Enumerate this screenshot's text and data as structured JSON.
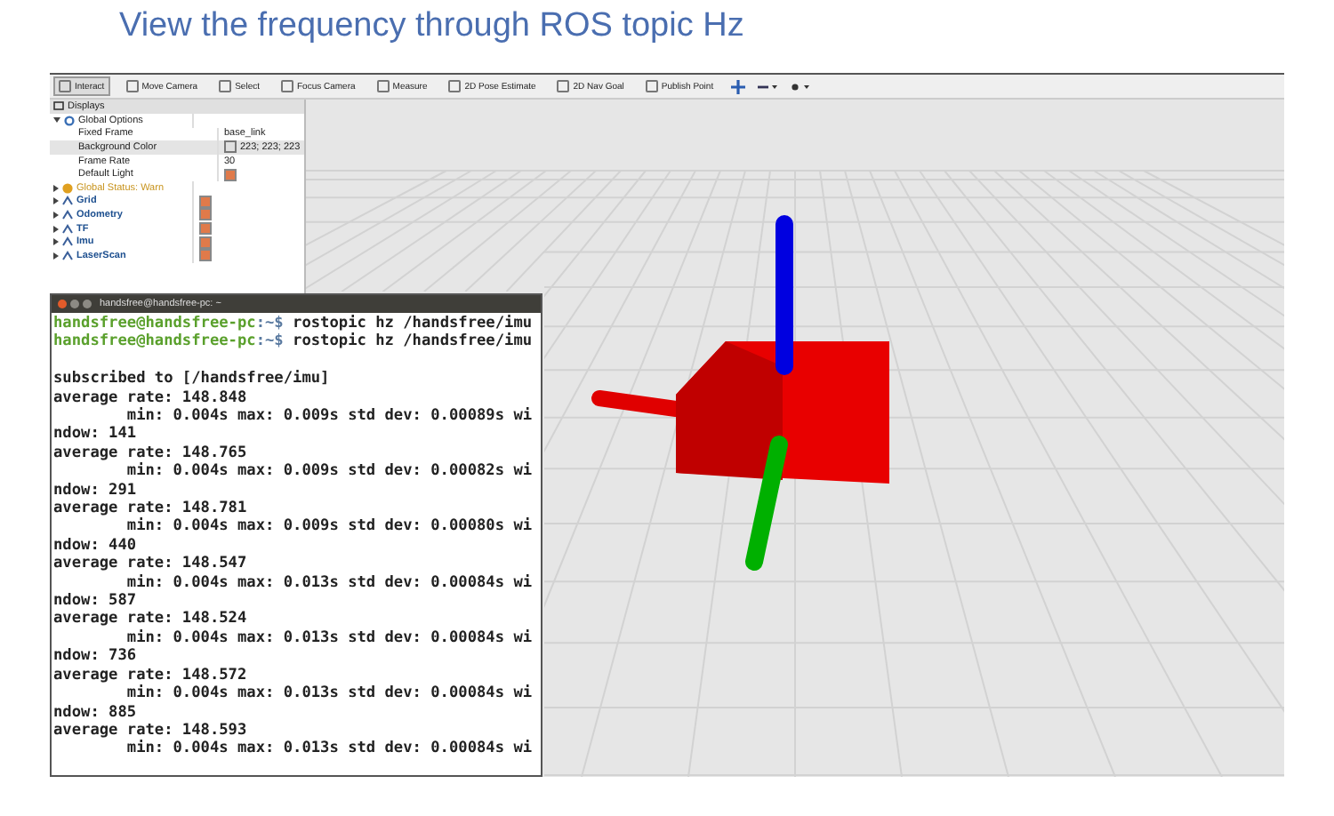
{
  "title": "View the frequency through ROS topic Hz",
  "toolbar": [
    {
      "label": "Interact",
      "selected": true
    },
    {
      "label": "Move Camera",
      "selected": false
    },
    {
      "label": "Select",
      "selected": false
    },
    {
      "label": "Focus Camera",
      "selected": false
    },
    {
      "label": "Measure",
      "selected": false
    },
    {
      "label": "2D Pose Estimate",
      "selected": false
    },
    {
      "label": "2D Nav Goal",
      "selected": false
    },
    {
      "label": "Publish Point",
      "selected": false
    }
  ],
  "displays": {
    "title": "Displays",
    "items": [
      {
        "label": "Global Options",
        "kind": "group",
        "expanded": true,
        "selected": false,
        "children": [
          {
            "label": "Fixed Frame",
            "value": "base_link",
            "selected": false
          },
          {
            "label": "Background Color",
            "value": "223; 223; 223",
            "kind": "color",
            "selected": true
          },
          {
            "label": "Frame Rate",
            "value": "30",
            "selected": false
          },
          {
            "label": "Default Light",
            "checked": true,
            "selected": false
          }
        ]
      },
      {
        "label": "Global Status: Warn",
        "kind": "status",
        "expanded": false,
        "selected": false
      },
      {
        "label": "Grid",
        "kind": "display",
        "expanded": false,
        "checked": true,
        "selected": false
      },
      {
        "label": "Odometry",
        "kind": "display",
        "expanded": false,
        "checked": true,
        "selected": false
      },
      {
        "label": "TF",
        "kind": "display",
        "expanded": false,
        "checked": true,
        "selected": false
      },
      {
        "label": "Imu",
        "kind": "display",
        "expanded": false,
        "checked": true,
        "selected": false
      },
      {
        "label": "LaserScan",
        "kind": "display",
        "expanded": false,
        "checked": true,
        "selected": false
      }
    ]
  },
  "terminal": {
    "title": "handsfree@handsfree-pc: ~",
    "lines": [
      {
        "kind": "prompt",
        "user": "handsfree@handsfree-pc",
        "path": ":~$",
        "command": "rostopic hz /handsfree/imu"
      },
      {
        "kind": "prompt",
        "user": "handsfree@handsfree-pc",
        "path": ":~$",
        "command": "rostopic hz /handsfree/imu"
      },
      {
        "kind": "blank"
      },
      {
        "kind": "output",
        "text": "subscribed to [/handsfree/imu]"
      },
      {
        "kind": "output",
        "text": "average rate: 148.848"
      },
      {
        "kind": "output",
        "text": "        min: 0.004s max: 0.009s std dev: 0.00089s wi"
      },
      {
        "kind": "output",
        "text": "ndow: 141"
      },
      {
        "kind": "output",
        "text": "average rate: 148.765"
      },
      {
        "kind": "output",
        "text": "        min: 0.004s max: 0.009s std dev: 0.00082s wi"
      },
      {
        "kind": "output",
        "text": "ndow: 291"
      },
      {
        "kind": "output",
        "text": "average rate: 148.781"
      },
      {
        "kind": "output",
        "text": "        min: 0.004s max: 0.009s std dev: 0.00080s wi"
      },
      {
        "kind": "output",
        "text": "ndow: 440"
      },
      {
        "kind": "output",
        "text": "average rate: 148.547"
      },
      {
        "kind": "output",
        "text": "        min: 0.004s max: 0.013s std dev: 0.00084s wi"
      },
      {
        "kind": "output",
        "text": "ndow: 587"
      },
      {
        "kind": "output",
        "text": "average rate: 148.524"
      },
      {
        "kind": "output",
        "text": "        min: 0.004s max: 0.013s std dev: 0.00084s wi"
      },
      {
        "kind": "output",
        "text": "ndow: 736"
      },
      {
        "kind": "output",
        "text": "average rate: 148.572"
      },
      {
        "kind": "output",
        "text": "        min: 0.004s max: 0.013s std dev: 0.00084s wi"
      },
      {
        "kind": "output",
        "text": "ndow: 885"
      },
      {
        "kind": "output",
        "text": "average rate: 148.593"
      },
      {
        "kind": "output",
        "text": "        min: 0.004s max: 0.013s std dev: 0.00084s wi"
      }
    ]
  }
}
